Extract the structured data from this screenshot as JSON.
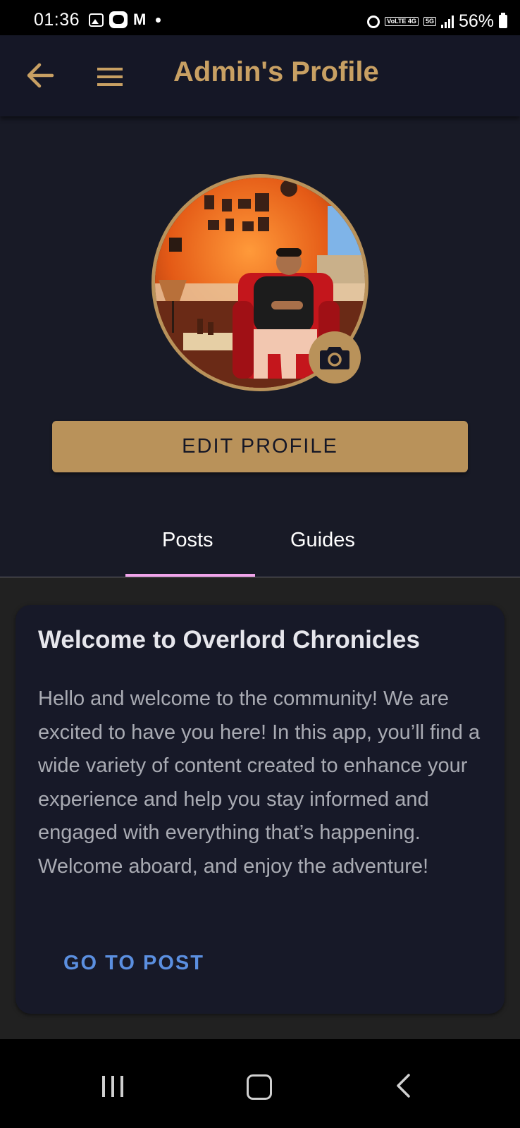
{
  "status_bar": {
    "time": "01:36",
    "battery": "56%",
    "network_tag_1": "VoLTE 4G",
    "network_tag_2": "5G",
    "icons": [
      "gallery-icon",
      "face-app-icon",
      "gmail-icon",
      "notification-dot-icon",
      "alarm-icon",
      "signal-icon",
      "battery-icon"
    ]
  },
  "app_bar": {
    "title": "Admin's Profile",
    "back_icon": "arrow-left-icon",
    "menu_icon": "hamburger-menu-icon"
  },
  "profile": {
    "camera_icon": "camera-icon",
    "edit_button_label": "EDIT PROFILE"
  },
  "tabs": [
    {
      "label": "Posts",
      "selected": true
    },
    {
      "label": "Guides",
      "selected": false
    }
  ],
  "post": {
    "title": "Welcome to Overlord Chronicles",
    "body": "Hello and welcome to the community! We are excited to have you here! In this app, you’ll find a wide variety of content created to enhance your experience and help you stay informed and engaged with everything that’s happening. Welcome aboard, and enjoy the adventure!",
    "link_label": "GO TO POST"
  },
  "nav_bar": {
    "icons": [
      "recent-apps-icon",
      "home-icon",
      "back-icon"
    ]
  },
  "colors": {
    "background": "#181a26",
    "app_bar": "#151726",
    "accent_gold": "#b9925a",
    "title_gold": "#c8a063",
    "tab_indicator": "#f0a3ea",
    "link_blue": "#5b8fe0"
  }
}
